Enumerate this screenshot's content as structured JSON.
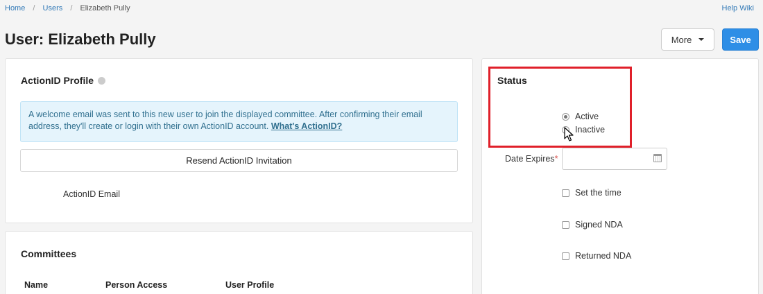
{
  "breadcrumb": {
    "home": "Home",
    "users": "Users",
    "current": "Elizabeth Pully"
  },
  "help_wiki": "Help Wiki",
  "page_title": "User: Elizabeth Pully",
  "header": {
    "more_label": "More",
    "save_label": "Save"
  },
  "profile": {
    "heading": "ActionID Profile",
    "alert_text": "A welcome email was sent to this new user to join the displayed committee. After confirming their email address, they'll create or login with their own ActionID account.",
    "alert_link": "What's ActionID?",
    "resend_label": "Resend ActionID Invitation",
    "email_label": "ActionID Email"
  },
  "committees": {
    "heading": "Committees",
    "columns": [
      "Name",
      "Person Access",
      "User Profile"
    ]
  },
  "status": {
    "heading": "Status",
    "options": [
      "Active",
      "Inactive"
    ],
    "selected": "Active",
    "date_expires_label": "Date Expires",
    "date_expires_value": "",
    "required_mark": "*",
    "checkboxes": [
      "Set the time",
      "Signed NDA",
      "Returned NDA"
    ]
  }
}
